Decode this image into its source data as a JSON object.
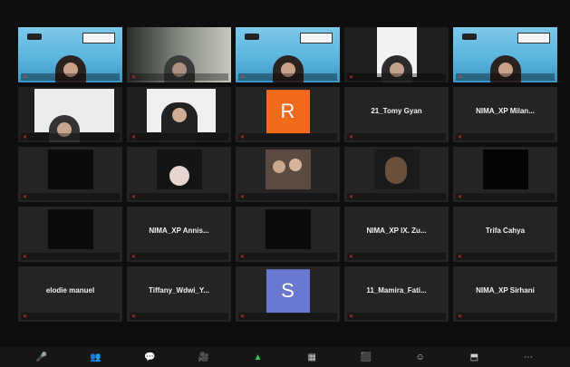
{
  "participants": [
    {
      "name": "",
      "type": "sky"
    },
    {
      "name": "",
      "type": "grey"
    },
    {
      "name": "",
      "type": "sky"
    },
    {
      "name": "",
      "type": "dark-person"
    },
    {
      "name": "",
      "type": "sky"
    },
    {
      "name": "",
      "type": "white-person"
    },
    {
      "name": "",
      "type": "white-hijab"
    },
    {
      "name": "",
      "type": "avatar",
      "letter": "R",
      "color": "#f26b1d"
    },
    {
      "name": "",
      "type": "text",
      "center": "21_Tomy Gyan"
    },
    {
      "name": "",
      "type": "text",
      "center": "NIMA_XP Milan..."
    },
    {
      "name": "",
      "type": "black-photo"
    },
    {
      "name": "",
      "type": "dark-person2"
    },
    {
      "name": "",
      "type": "group-photo"
    },
    {
      "name": "",
      "type": "hijab-photo"
    },
    {
      "name": "",
      "type": "black-photo2"
    },
    {
      "name": "",
      "type": "black-photo"
    },
    {
      "name": "",
      "type": "text",
      "center": "NIMA_XP Annis..."
    },
    {
      "name": "",
      "type": "black-photo"
    },
    {
      "name": "",
      "type": "text",
      "center": "NIMA_XP IX. Zu..."
    },
    {
      "name": "",
      "type": "text",
      "center": "Trifa Cahya"
    },
    {
      "name": "",
      "type": "text",
      "center": "elodie manuel"
    },
    {
      "name": "",
      "type": "text",
      "center": "Tiffany_Wdwi_Y..."
    },
    {
      "name": "",
      "type": "avatar",
      "letter": "S",
      "color": "#6a78d1"
    },
    {
      "name": "",
      "type": "text",
      "center": "11_Mamira_Fati..."
    },
    {
      "name": "",
      "type": "text",
      "center": "NIMA_XP Sirhani"
    }
  ],
  "toolbar": {
    "buttons": [
      {
        "name": "mute-button",
        "icon": "🎤",
        "color": "normal"
      },
      {
        "name": "participants-button",
        "icon": "👥",
        "color": "normal"
      },
      {
        "name": "chat-button",
        "icon": "💬",
        "color": "normal"
      },
      {
        "name": "stop-video-button",
        "icon": "🎥",
        "color": "red"
      },
      {
        "name": "share-screen-button",
        "icon": "▲",
        "color": "green"
      },
      {
        "name": "layout-button",
        "icon": "▦",
        "color": "normal"
      },
      {
        "name": "record-button",
        "icon": "⬛",
        "color": "normal"
      },
      {
        "name": "reactions-button",
        "icon": "☺",
        "color": "normal"
      },
      {
        "name": "apps-button",
        "icon": "⬒",
        "color": "normal"
      },
      {
        "name": "more-button",
        "icon": "⋯",
        "color": "normal"
      }
    ]
  }
}
